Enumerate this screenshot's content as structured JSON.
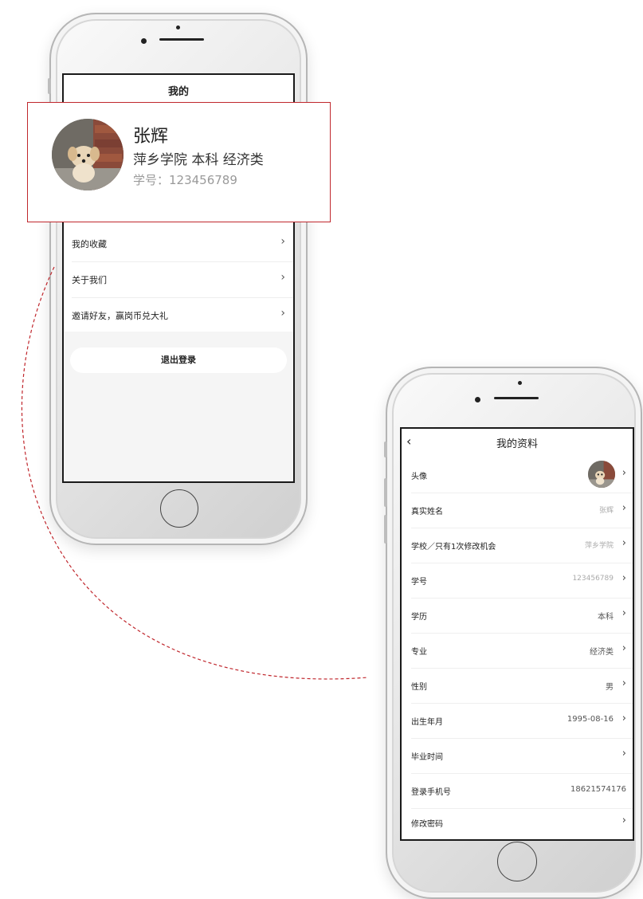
{
  "screen_my": {
    "title": "我的",
    "menu": [
      {
        "label": "我的收藏",
        "chevron": "›"
      },
      {
        "label": "关于我们",
        "chevron": "›"
      },
      {
        "label": "邀请好友，赢岗币兑大礼",
        "chevron": "›"
      }
    ],
    "logout_label": "退出登录"
  },
  "callout": {
    "name": "张辉",
    "school_line": "萍乡学院 本科 经济类",
    "student_id": "学号：123456789"
  },
  "screen_profile": {
    "back_icon": "‹",
    "title": "我的资料",
    "rows": [
      {
        "label": "头像",
        "value": "",
        "chevron": "›"
      },
      {
        "label": "真实姓名",
        "value": "张辉",
        "chevron": "›"
      },
      {
        "label": "学校／只有1次修改机会",
        "value": "萍乡学院",
        "chevron": "›"
      },
      {
        "label": "学号",
        "value": "123456789",
        "chevron": "›"
      },
      {
        "label": "学历",
        "value": "本科",
        "chevron": "›"
      },
      {
        "label": "专业",
        "value": "经济类",
        "chevron": "›"
      },
      {
        "label": "性别",
        "value": "男",
        "chevron": "›"
      },
      {
        "label": "出生年月",
        "value": "1995-08-16",
        "chevron": "›"
      },
      {
        "label": "毕业时间",
        "value": "",
        "chevron": "›"
      },
      {
        "label": "登录手机号",
        "value": "18621574176",
        "chevron": ""
      },
      {
        "label": "修改密码",
        "value": "",
        "chevron": "›"
      }
    ]
  },
  "colors": {
    "callout_border": "#c0272d",
    "dashed_arc": "#c0272d"
  }
}
